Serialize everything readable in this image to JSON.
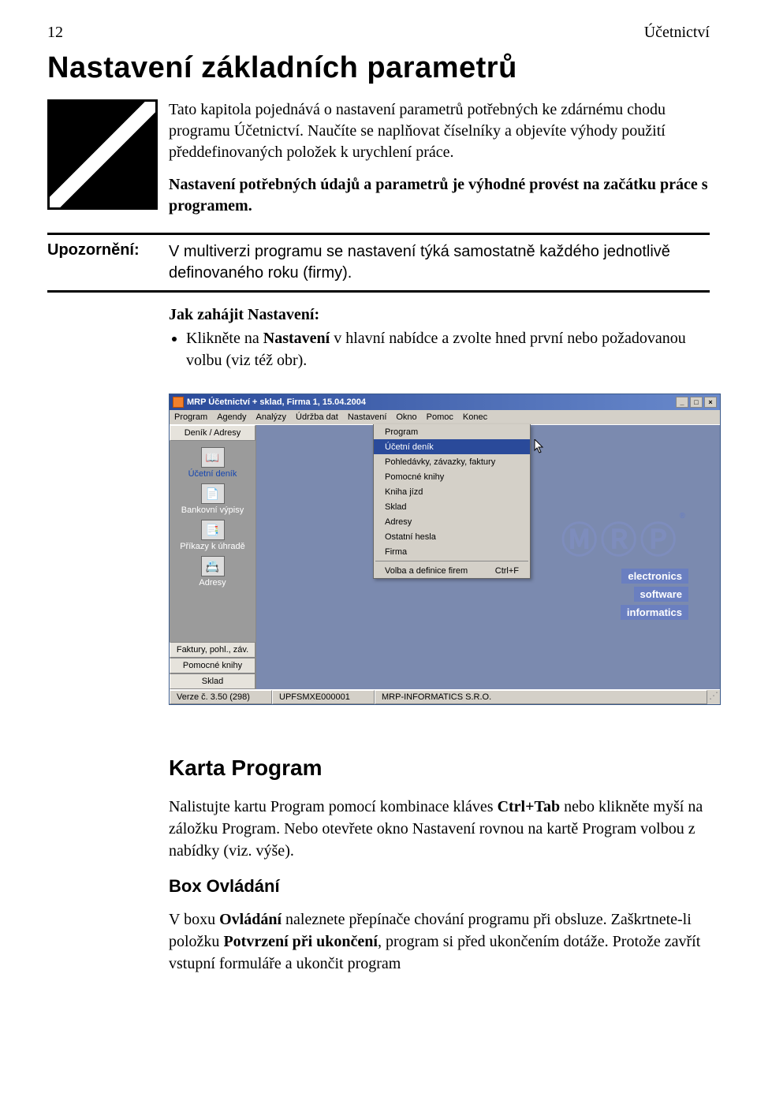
{
  "header": {
    "page_num": "12",
    "section": "Účetnictví"
  },
  "heading": "Nastavení základních parametrů",
  "intro": {
    "p1": "Tato kapitola pojednává o nastavení parametrů potřebných ke zdárnému chodu programu Účetnictví. Naučíte se naplňovat číselníky a objevíte výhody použití předdefinovaných položek k urychlení práce.",
    "p2": "Nastavení potřebných údajů a parametrů je výhodné provést na začátku práce s programem."
  },
  "upozorneni": {
    "label": "Upozornění:",
    "body": "V multiverzi programu se nastavení týká samostatně každého jednotlivě definovaného roku (firmy)."
  },
  "howto": {
    "head": "Jak zahájit Nastavení:",
    "bullet_pre": "Klikněte na ",
    "bullet_bold": "Nastavení",
    "bullet_post": " v hlavní nabídce a zvolte hned první nebo požadovanou volbu (viz též obr)."
  },
  "window": {
    "title": "MRP Účetnictví + sklad, Firma 1, 15.04.2004",
    "menus": [
      "Program",
      "Agendy",
      "Analýzy",
      "Údržba dat",
      "Nastavení",
      "Okno",
      "Pomoc",
      "Konec"
    ],
    "side_top": "Deník / Adresy",
    "side_items": [
      {
        "label": "Účetní deník",
        "glyph": "📖"
      },
      {
        "label": "Bankovní výpisy",
        "glyph": "📄"
      },
      {
        "label": "Příkazy k úhradě",
        "glyph": "📑"
      },
      {
        "label": "Adresy",
        "glyph": "📇"
      }
    ],
    "side_bottom": [
      "Faktury, pohl., záv.",
      "Pomocné knihy",
      "Sklad"
    ],
    "dropdown": [
      {
        "label": "Program",
        "sel": false
      },
      {
        "label": "Účetní deník",
        "sel": true
      },
      {
        "label": "Pohledávky, závazky, faktury",
        "sel": false
      },
      {
        "label": "Pomocné knihy",
        "sel": false
      },
      {
        "label": "Kniha jízd",
        "sel": false
      },
      {
        "label": "Sklad",
        "sel": false
      },
      {
        "label": "Adresy",
        "sel": false
      },
      {
        "label": "Ostatní hesla",
        "sel": false
      },
      {
        "label": "Firma",
        "sel": false
      }
    ],
    "dd_last": {
      "label": "Volba a definice firem",
      "shortcut": "Ctrl+F"
    },
    "logo": {
      "brand": "ⓂⓇⓅ",
      "tags": [
        "electronics",
        "software",
        "informatics"
      ]
    },
    "status": {
      "ver": "Verze č. 3.50 (298)",
      "lic": "UPFSMXE000001",
      "company": "MRP-INFORMATICS S.R.O."
    },
    "winbtns": [
      "_",
      "□",
      "×"
    ]
  },
  "karta": {
    "head": "Karta Program",
    "p1_a": "Nalistujte kartu Program pomocí kombinace kláves ",
    "p1_b": "Ctrl+Tab",
    "p1_c": " nebo klikněte myší na záložku Program. Nebo otevřete okno Nastavení rovnou na kartě Program volbou z nabídky (viz. výše).",
    "boxhead": "Box Ovládání",
    "p2_a": "V boxu ",
    "p2_b": "Ovládání",
    "p2_c": " naleznete přepínače chování programu při obsluze. Zaškrtnete-li položku ",
    "p2_d": "Potvrzení při ukončení",
    "p2_e": ", program si před ukončením dotáže. Protože zavřít vstupní formuláře a ukončit program"
  }
}
